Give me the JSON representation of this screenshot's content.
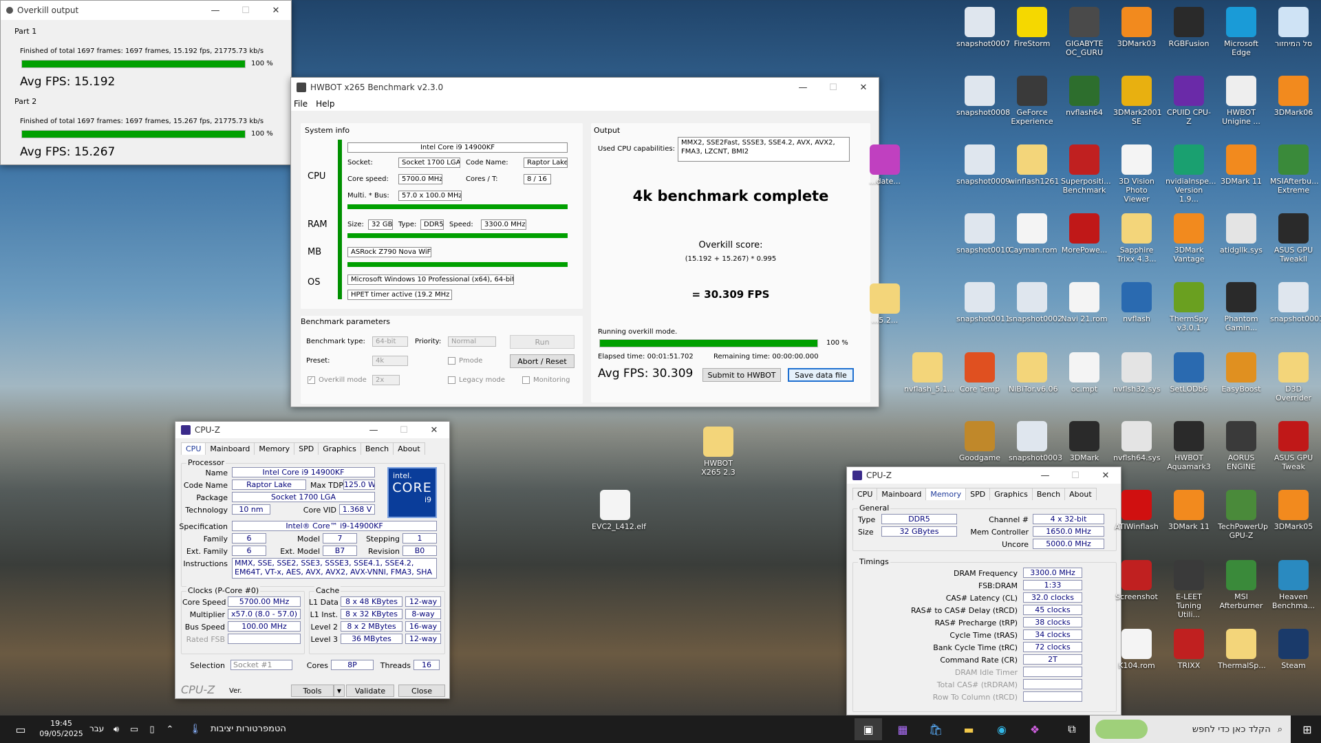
{
  "overkill": {
    "title": "Overkill output",
    "parts": [
      {
        "label": "Part 1",
        "status": "Finished of total 1697 frames: 1697 frames, 15.192 fps,  21775.73 kb/s",
        "percent": "100 %",
        "progress": 1.0,
        "avg": "Avg FPS: 15.192"
      },
      {
        "label": "Part 2",
        "status": "Finished of total 1697 frames: 1697 frames, 15.267 fps,  21775.73 kb/s",
        "percent": "100 %",
        "progress": 1.0,
        "avg": "Avg FPS: 15.267"
      }
    ]
  },
  "hwbot": {
    "title": "HWBOT x265 Benchmark v2.3.0",
    "menu": [
      "File",
      "Help"
    ],
    "sysinfo": {
      "legend": "System info",
      "cpu_label": "CPU",
      "ram_label": "RAM",
      "mb_label": "MB",
      "os_label": "OS",
      "cpu_name": "Intel Core i9 14900KF",
      "socket_l": "Socket:",
      "socket": "Socket 1700 LGA",
      "codename_l": "Code Name:",
      "codename": "Raptor Lake",
      "corespeed_l": "Core speed:",
      "corespeed": "5700.0 MHz",
      "cores_l": "Cores / T:",
      "cores": "8 / 16",
      "multi_l": "Multi. * Bus:",
      "multi": "57.0 x 100.0 MHz",
      "size_l": "Size:",
      "size": "32 GB",
      "type_l": "Type:",
      "type": "DDR5",
      "speed_l": "Speed:",
      "speed": "3300.0 MHz",
      "mb": "ASRock Z790 Nova WiFi",
      "os": "Microsoft Windows 10  Professional (x64), 64-bit",
      "hpet": "HPET timer active (19.2 MHz )"
    },
    "params": {
      "legend": "Benchmark parameters",
      "type_l": "Benchmark type:",
      "type": "64-bit",
      "priority_l": "Priority:",
      "priority": "Normal",
      "run": "Run",
      "preset_l": "Preset:",
      "preset": "4k",
      "pmode": "Pmode",
      "abort": "Abort / Reset",
      "overkill_l": "Overkill mode",
      "overkill": "2x",
      "legacy": "Legacy mode",
      "monitoring": "Monitoring"
    },
    "output": {
      "legend": "Output",
      "caps_l": "Used CPU capabilities:",
      "caps": "MMX2, SSE2Fast, SSSE3, SSE4.2, AVX, AVX2, FMA3, LZCNT, BMI2",
      "complete": "4k benchmark complete",
      "score_l": "Overkill score:",
      "formula": "(15.192 + 15.267) * 0.995",
      "result": "= 30.309 FPS",
      "running": "Running overkill mode.",
      "percent": "100 %",
      "progress": 1.0,
      "elapsed": "Elapsed time: 00:01:51.702",
      "remaining": "Remaining time: 00:00:00.000",
      "avg": "Avg FPS: 30.309",
      "submit": "Submit to HWBOT",
      "save": "Save data file"
    }
  },
  "cpuz1": {
    "title": "CPU-Z",
    "tabs": [
      "CPU",
      "Mainboard",
      "Memory",
      "SPD",
      "Graphics",
      "Bench",
      "About"
    ],
    "active": 0,
    "proc_legend": "Processor",
    "name_l": "Name",
    "name": "Intel Core i9 14900KF",
    "codename_l": "Code Name",
    "codename": "Raptor Lake",
    "maxtdp_l": "Max TDP",
    "maxtdp": "125.0 W",
    "package_l": "Package",
    "package": "Socket 1700 LGA",
    "tech_l": "Technology",
    "tech": "10 nm",
    "vcore_l": "Core VID",
    "vcore": "1.368 V",
    "spec_l": "Specification",
    "spec": "Intel® Core™ i9-14900KF",
    "family_l": "Family",
    "family": "6",
    "model_l": "Model",
    "model": "7",
    "stepping_l": "Stepping",
    "stepping": "1",
    "extfam_l": "Ext. Family",
    "extfam": "6",
    "extmod_l": "Ext. Model",
    "extmod": "B7",
    "rev_l": "Revision",
    "rev": "B0",
    "instr_l": "Instructions",
    "instr": "MMX, SSE, SSE2, SSE3, SSSE3, SSE4.1, SSE4.2, EM64T, VT-x, AES, AVX, AVX2, AVX-VNNI, FMA3, SHA",
    "intel_top": "intel.",
    "intel_core": "CORE",
    "intel_i9": "i9",
    "clocks_legend": "Clocks (P-Core #0)",
    "cs_l": "Core Speed",
    "cs": "5700.00 MHz",
    "mul_l": "Multiplier",
    "mul": "x57.0 (8.0 - 57.0)",
    "bus_l": "Bus Speed",
    "bus": "100.00 MHz",
    "fsb_l": "Rated FSB",
    "cache_legend": "Cache",
    "l1d_l": "L1 Data",
    "l1d": "8 x 48 KBytes",
    "l1d_w": "12-way",
    "l1i_l": "L1 Inst.",
    "l1i": "8 x 32 KBytes",
    "l1i_w": "8-way",
    "l2_l": "Level 2",
    "l2": "8 x 2 MBytes",
    "l2_w": "16-way",
    "l3_l": "Level 3",
    "l3": "36 MBytes",
    "l3_w": "12-way",
    "selection_l": "Selection",
    "selection": "Socket #1",
    "cores_l": "Cores",
    "cores": "8P",
    "threads_l": "Threads",
    "threads": "16",
    "brand": "CPU-Z",
    "ver": "Ver.",
    "tools": "Tools",
    "validate": "Validate",
    "close": "Close"
  },
  "cpuz2": {
    "title": "CPU-Z",
    "tabs": [
      "CPU",
      "Mainboard",
      "Memory",
      "SPD",
      "Graphics",
      "Bench",
      "About"
    ],
    "active": 2,
    "gen_legend": "General",
    "type_l": "Type",
    "type": "DDR5",
    "chan_l": "Channel #",
    "chan": "4 x 32-bit",
    "size_l": "Size",
    "size": "32 GBytes",
    "memctl_l": "Mem Controller",
    "memctl": "1650.0 MHz",
    "uncore_l": "Uncore",
    "uncore": "5000.0 MHz",
    "tim_legend": "Timings",
    "timings": [
      {
        "l": "DRAM Frequency",
        "v": "3300.0 MHz"
      },
      {
        "l": "FSB:DRAM",
        "v": "1:33"
      },
      {
        "l": "CAS# Latency (CL)",
        "v": "32.0 clocks"
      },
      {
        "l": "RAS# to CAS# Delay (tRCD)",
        "v": "45 clocks"
      },
      {
        "l": "RAS# Precharge (tRP)",
        "v": "38 clocks"
      },
      {
        "l": "Cycle Time (tRAS)",
        "v": "34 clocks"
      },
      {
        "l": "Bank Cycle Time (tRC)",
        "v": "72 clocks"
      },
      {
        "l": "Command Rate (CR)",
        "v": "2T"
      },
      {
        "l": "DRAM Idle Timer",
        "v": ""
      },
      {
        "l": "Total CAS# (tRDRAM)",
        "v": ""
      },
      {
        "l": "Row To Column (tRCD)",
        "v": ""
      }
    ]
  },
  "desktop_icons": [
    {
      "n": "snapshot0007",
      "c": "#dfe6ee"
    },
    {
      "n": "FireStorm",
      "c": "#f5d800"
    },
    {
      "n": "GIGABYTE OC_GURU",
      "c": "#4a4a4a"
    },
    {
      "n": "3DMark03",
      "c": "#f28a1e"
    },
    {
      "n": "RGBFusion",
      "c": "#2a2a2a"
    },
    {
      "n": "Microsoft Edge",
      "c": "#1a9bd7"
    },
    {
      "n": "סל המיחזור",
      "c": "#cfe3f5"
    },
    {
      "n": "snapshot0008",
      "c": "#dfe6ee"
    },
    {
      "n": "GeForce Experience",
      "c": "#3a3a3a"
    },
    {
      "n": "nvflash64",
      "c": "#2d6e2d"
    },
    {
      "n": "3DMark2001 SE",
      "c": "#e8b010"
    },
    {
      "n": "CPUID CPU-Z",
      "c": "#6a2aa8"
    },
    {
      "n": "HWBOT Unigine ...",
      "c": "#eeeeee"
    },
    {
      "n": "3DMark06",
      "c": "#f28a1e"
    },
    {
      "n": "snapshot0009",
      "c": "#dfe6ee"
    },
    {
      "n": "winflash1261",
      "c": "#f3d57a"
    },
    {
      "n": "Superpositi... Benchmark",
      "c": "#c02020"
    },
    {
      "n": "3D Vision Photo Viewer",
      "c": "#f4f4f4"
    },
    {
      "n": "nvidiaInspe... Version 1.9...",
      "c": "#1aa070"
    },
    {
      "n": "3DMark 11",
      "c": "#f28a1e"
    },
    {
      "n": "MSIAfterbu... Extreme",
      "c": "#3a8a3a"
    },
    {
      "n": "snapshot0010",
      "c": "#dfe6ee"
    },
    {
      "n": "Cayman.rom",
      "c": "#f4f4f4"
    },
    {
      "n": "MorePowe...",
      "c": "#c01818"
    },
    {
      "n": "Sapphire Trixx 4.3...",
      "c": "#f3d57a"
    },
    {
      "n": "3DMark Vantage",
      "c": "#f28a1e"
    },
    {
      "n": "atidgllk.sys",
      "c": "#e4e4e4"
    },
    {
      "n": "ASUS GPU Tweakll",
      "c": "#2a2a2a"
    },
    {
      "n": "snapshot0011",
      "c": "#dfe6ee"
    },
    {
      "n": "snapshot0002",
      "c": "#dfe6ee"
    },
    {
      "n": "Navi 21.rom",
      "c": "#f4f4f4"
    },
    {
      "n": "nvflash",
      "c": "#2a6ab0"
    },
    {
      "n": "ThermSpy v3.0.1",
      "c": "#6aa020"
    },
    {
      "n": "Phantom Gamin...",
      "c": "#2a2a2a"
    },
    {
      "n": "snapshot0001",
      "c": "#dfe6ee"
    },
    {
      "n": "nvflash_5.1...",
      "c": "#f3d57a"
    },
    {
      "n": "Core Temp",
      "c": "#e05020"
    },
    {
      "n": "NiBiTor.v6.06",
      "c": "#f3d57a"
    },
    {
      "n": "oc.mpt",
      "c": "#f4f4f4"
    },
    {
      "n": "nvflsh32.sys",
      "c": "#e4e4e4"
    },
    {
      "n": "SetLODb6",
      "c": "#2a6ab0"
    },
    {
      "n": "EasyBoost",
      "c": "#e09020"
    },
    {
      "n": "D3D Overrider",
      "c": "#f3d57a"
    },
    {
      "n": "Goodgame",
      "c": "#c0882a"
    },
    {
      "n": "snapshot0003",
      "c": "#dfe6ee"
    },
    {
      "n": "3DMark",
      "c": "#2a2a2a"
    },
    {
      "n": "nvflsh64.sys",
      "c": "#e4e4e4"
    },
    {
      "n": "HWBOT Aquamark3",
      "c": "#2a2a2a"
    },
    {
      "n": "AORUS ENGINE",
      "c": "#3a3a3a"
    },
    {
      "n": "ASUS GPU Tweak",
      "c": "#c01818"
    },
    {
      "n": "ATIWinflash",
      "c": "#d01010"
    },
    {
      "n": "3DMark 11",
      "c": "#f28a1e"
    },
    {
      "n": "TechPowerUp GPU-Z",
      "c": "#4a8a3a"
    },
    {
      "n": "3DMark05",
      "c": "#f28a1e"
    },
    {
      "n": "Screenshot",
      "c": "#c02020"
    },
    {
      "n": "E-LEET Tuning Utili...",
      "c": "#3a3a3a"
    },
    {
      "n": "MSI Afterburner",
      "c": "#3a8a3a"
    },
    {
      "n": "Heaven Benchma...",
      "c": "#2a8ac0"
    },
    {
      "n": "K104.rom",
      "c": "#f4f4f4"
    },
    {
      "n": "TRIXX",
      "c": "#c02020"
    },
    {
      "n": "ThermalSp...",
      "c": "#f3d57a"
    },
    {
      "n": "Steam",
      "c": "#1a3a6a"
    },
    {
      "n": "HWBOT X265 2.3",
      "c": "#f3d57a"
    },
    {
      "n": "EVC2_L412.elf",
      "c": "#f4f4f4"
    },
    {
      "n": "...date...",
      "c": "#c040c0"
    },
    {
      "n": "...5.2...",
      "c": "#f3d57a"
    }
  ],
  "taskbar": {
    "time": "19:45",
    "date": "09/05/2025",
    "lang": "עבר",
    "weather": "הטמפרטורות יציבות",
    "search": "הקלד כאן כדי לחפש"
  }
}
